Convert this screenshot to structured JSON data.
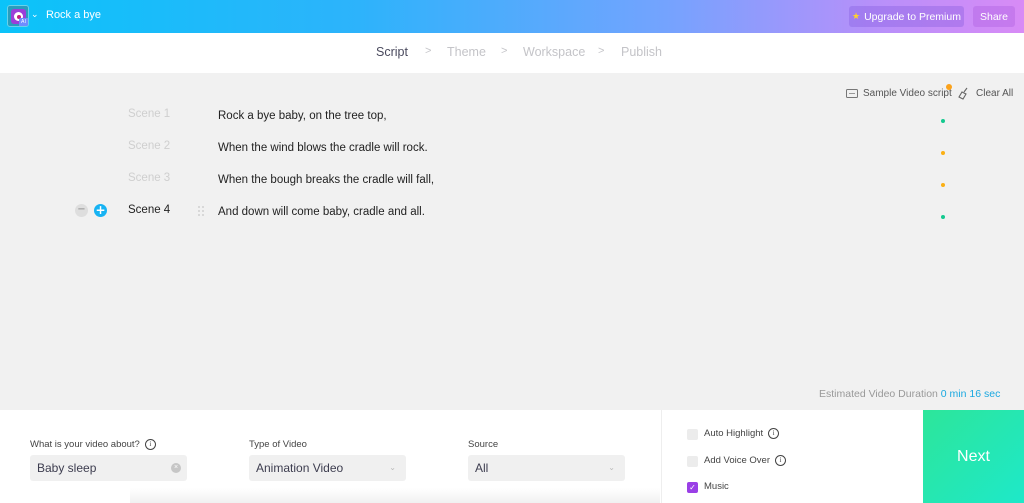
{
  "header": {
    "project_title": "Rock a bye",
    "logo_badge": "AI",
    "upgrade_label": "Upgrade to Premium",
    "share_label": "Share"
  },
  "steps": [
    {
      "label": "Script",
      "active": true
    },
    {
      "label": "Theme",
      "active": false
    },
    {
      "label": "Workspace",
      "active": false
    },
    {
      "label": "Publish",
      "active": false
    }
  ],
  "step_separator": ">",
  "tools": {
    "sample_label": "Sample Video script",
    "clear_label": "Clear All"
  },
  "scenes": [
    {
      "label": "Scene 1",
      "text": "Rock a bye baby, on the tree top,",
      "status_color": "#14c98f",
      "active": false
    },
    {
      "label": "Scene 2",
      "text": "When the wind blows the cradle will rock.",
      "status_color": "#fbb014",
      "active": false
    },
    {
      "label": "Scene 3",
      "text": "When the bough breaks the cradle will fall,",
      "status_color": "#fbb014",
      "active": false
    },
    {
      "label": "Scene 4",
      "text": "And down will come baby, cradle and all.",
      "status_color": "#14c98f",
      "active": true
    }
  ],
  "duration": {
    "label": "Estimated Video Duration",
    "value": "0 min 16 sec"
  },
  "form": {
    "about_label": "What is your video about?",
    "about_value": "Baby sleep",
    "type_label": "Type of Video",
    "type_value": "Animation Video",
    "source_label": "Source",
    "source_value": "All"
  },
  "options": {
    "auto_highlight": {
      "label": "Auto Highlight",
      "checked": false
    },
    "voice_over": {
      "label": "Add Voice Over",
      "checked": false
    },
    "music": {
      "label": "Music",
      "checked": true
    }
  },
  "next_label": "Next",
  "colors": {
    "accent": "#1aa8e0",
    "next": "#20e6b5",
    "checkbox": "#9a3fe6"
  }
}
